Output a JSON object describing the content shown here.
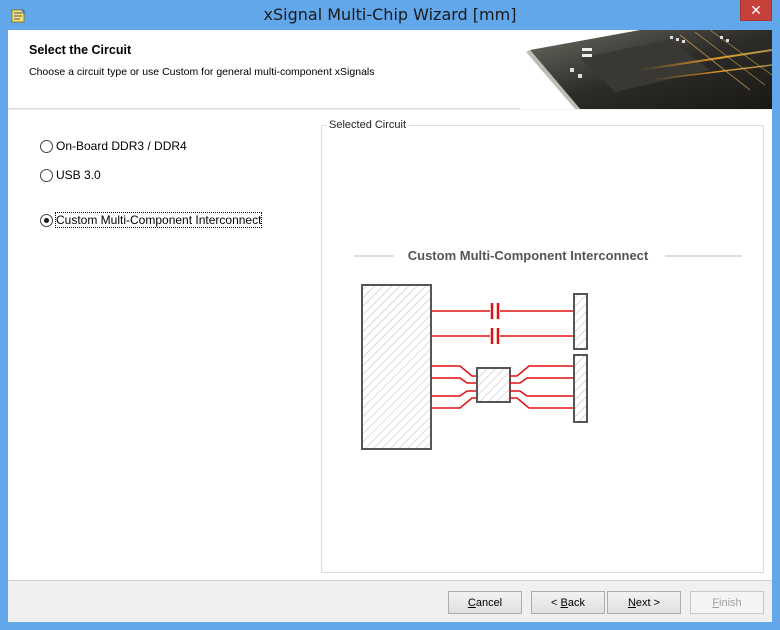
{
  "window": {
    "title": "xSignal Multi-Chip Wizard [mm]",
    "close_glyph": "✕",
    "icon": "wizard-app-icon"
  },
  "header": {
    "title": "Select the Circuit",
    "subtitle": "Choose a circuit type or use Custom for general multi-component xSignals"
  },
  "options": [
    {
      "label": "On-Board DDR3 / DDR4",
      "selected": false
    },
    {
      "label": "USB 3.0",
      "selected": false
    },
    {
      "label": "Custom Multi-Component Interconnect",
      "selected": true
    }
  ],
  "preview": {
    "legend": "Selected Circuit",
    "diagram_title": "Custom Multi-Component Interconnect"
  },
  "buttons": {
    "cancel": {
      "prefix": "",
      "accel": "C",
      "rest": "ancel",
      "enabled": true
    },
    "back": {
      "prefix": "< ",
      "accel": "B",
      "rest": "ack",
      "enabled": true
    },
    "next": {
      "prefix": "",
      "accel": "N",
      "rest": "ext >",
      "enabled": true
    },
    "finish": {
      "prefix": "",
      "accel": "F",
      "rest": "inish",
      "enabled": false
    }
  },
  "colors": {
    "trace": "#e01010",
    "component_outline": "#555555",
    "titlebar": "#62a7ea"
  }
}
